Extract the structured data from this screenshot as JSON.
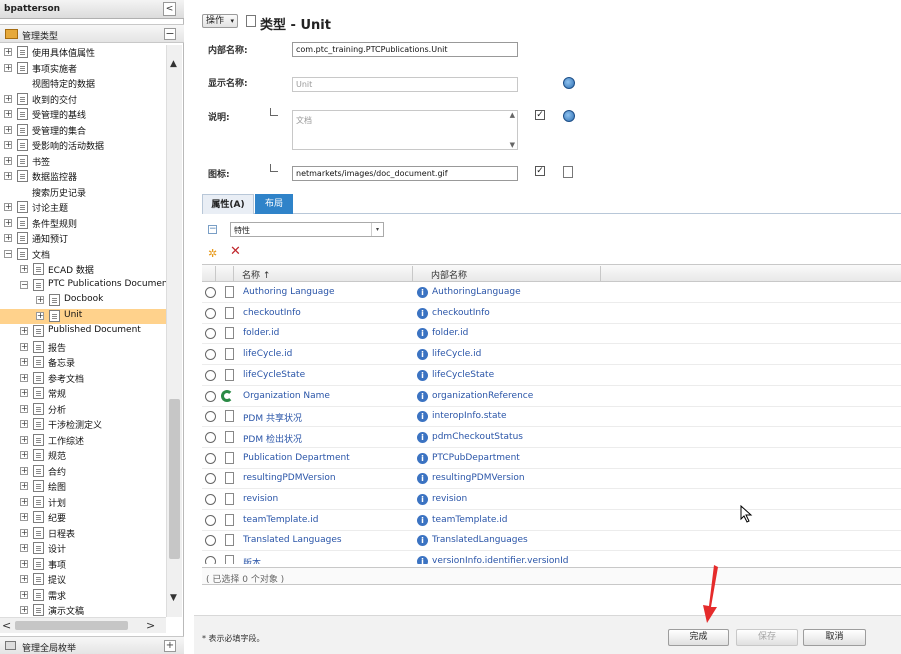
{
  "left_panel": {
    "user_name": "bpatterson",
    "collapse_glyph": "<",
    "section_title": "管理类型",
    "tree": [
      {
        "label": "使用具体值属性",
        "level": 0,
        "toggle": "+",
        "icon": "doc"
      },
      {
        "label": "事项实施者",
        "level": 0,
        "toggle": "+",
        "icon": "doc"
      },
      {
        "label": "视图特定的数据",
        "level": 0,
        "toggle": "",
        "icon": ""
      },
      {
        "label": "收到的交付",
        "level": 0,
        "toggle": "+",
        "icon": "doc"
      },
      {
        "label": "受管理的基线",
        "level": 0,
        "toggle": "+",
        "icon": "doc"
      },
      {
        "label": "受管理的集合",
        "level": 0,
        "toggle": "+",
        "icon": "doc"
      },
      {
        "label": "受影响的活动数据",
        "level": 0,
        "toggle": "+",
        "icon": "doc"
      },
      {
        "label": "书签",
        "level": 0,
        "toggle": "+",
        "icon": "doc"
      },
      {
        "label": "数据监控器",
        "level": 0,
        "toggle": "+",
        "icon": "doc"
      },
      {
        "label": "搜索历史记录",
        "level": 0,
        "toggle": "",
        "icon": ""
      },
      {
        "label": "讨论主题",
        "level": 0,
        "toggle": "+",
        "icon": "doc"
      },
      {
        "label": "条件型规则",
        "level": 0,
        "toggle": "+",
        "icon": "doc"
      },
      {
        "label": "通知预订",
        "level": 0,
        "toggle": "+",
        "icon": "doc"
      },
      {
        "label": "文档",
        "level": 0,
        "toggle": "−",
        "icon": "doc"
      },
      {
        "label": "ECAD 数据",
        "level": 1,
        "toggle": "+",
        "icon": "doc"
      },
      {
        "label": "PTC Publications Document",
        "level": 1,
        "toggle": "−",
        "icon": "doc"
      },
      {
        "label": "Docbook",
        "level": 2,
        "toggle": "+",
        "icon": "doc"
      },
      {
        "label": "Unit",
        "level": 2,
        "toggle": "+",
        "icon": "doc",
        "selected": true
      },
      {
        "label": "Published Document",
        "level": 1,
        "toggle": "+",
        "icon": "doc"
      },
      {
        "label": "报告",
        "level": 1,
        "toggle": "+",
        "icon": "doc"
      },
      {
        "label": "备忘录",
        "level": 1,
        "toggle": "+",
        "icon": "doc"
      },
      {
        "label": "参考文档",
        "level": 1,
        "toggle": "+",
        "icon": "doc"
      },
      {
        "label": "常规",
        "level": 1,
        "toggle": "+",
        "icon": "doc"
      },
      {
        "label": "分析",
        "level": 1,
        "toggle": "+",
        "icon": "doc"
      },
      {
        "label": "干涉检测定义",
        "level": 1,
        "toggle": "+",
        "icon": "doc"
      },
      {
        "label": "工作综述",
        "level": 1,
        "toggle": "+",
        "icon": "doc"
      },
      {
        "label": "规范",
        "level": 1,
        "toggle": "+",
        "icon": "doc"
      },
      {
        "label": "合约",
        "level": 1,
        "toggle": "+",
        "icon": "doc"
      },
      {
        "label": "绘图",
        "level": 1,
        "toggle": "+",
        "icon": "doc"
      },
      {
        "label": "计划",
        "level": 1,
        "toggle": "+",
        "icon": "doc"
      },
      {
        "label": "纪要",
        "level": 1,
        "toggle": "+",
        "icon": "doc"
      },
      {
        "label": "日程表",
        "level": 1,
        "toggle": "+",
        "icon": "doc"
      },
      {
        "label": "设计",
        "level": 1,
        "toggle": "+",
        "icon": "doc"
      },
      {
        "label": "事项",
        "level": 1,
        "toggle": "+",
        "icon": "doc"
      },
      {
        "label": "提议",
        "level": 1,
        "toggle": "+",
        "icon": "doc"
      },
      {
        "label": "需求",
        "level": 1,
        "toggle": "+",
        "icon": "doc"
      },
      {
        "label": "演示文稿",
        "level": 1,
        "toggle": "+",
        "icon": "doc"
      }
    ],
    "scroll_up": "▲",
    "scroll_down": "▼",
    "scroll_left": "<",
    "scroll_right": ">",
    "bottom_section_title": "管理全局枚举",
    "bottom_plus": "+"
  },
  "header": {
    "action_menu_label": "操作",
    "action_menu_caret": "▾",
    "title": "类型 - Unit"
  },
  "form": {
    "internal_name_label": "内部名称:",
    "internal_name_value": "com.ptc_training.PTCPublications.Unit",
    "display_name_label": "显示名称:",
    "display_name_value": "Unit",
    "description_label": "说明:",
    "description_value": "文档",
    "description_checked": "✓",
    "icon_label": "图标:",
    "icon_value": "netmarkets/images/doc_document.gif",
    "icon_checked": "✓"
  },
  "tabs": [
    {
      "label": "属性(A)",
      "active": false
    },
    {
      "label": "布局",
      "active": true
    }
  ],
  "group_toggle": "−",
  "group_select": {
    "value": "特性",
    "caret": "▾"
  },
  "toolbar": {
    "new_icon": "✲",
    "delete_icon": "✕"
  },
  "table": {
    "columns": [
      "名称 ↑",
      "内部名称"
    ],
    "rows": [
      {
        "name": "Authoring Language",
        "internal": "AuthoringLanguage",
        "icon": "doc"
      },
      {
        "name": "checkoutInfo",
        "internal": "checkoutInfo",
        "icon": "doc"
      },
      {
        "name": "folder.id",
        "internal": "folder.id",
        "icon": "doc"
      },
      {
        "name": "lifeCycle.id",
        "internal": "lifeCycle.id",
        "icon": "doc"
      },
      {
        "name": "lifeCycleState",
        "internal": "lifeCycleState",
        "icon": "doc"
      },
      {
        "name": "Organization Name",
        "internal": "organizationReference",
        "icon": "ref"
      },
      {
        "name": "PDM 共享状况",
        "internal": "interopInfo.state",
        "icon": "doc"
      },
      {
        "name": "PDM 检出状况",
        "internal": "pdmCheckoutStatus",
        "icon": "doc"
      },
      {
        "name": "Publication Department",
        "internal": "PTCPubDepartment",
        "icon": "doc"
      },
      {
        "name": "resultingPDMVersion",
        "internal": "resultingPDMVersion",
        "icon": "doc"
      },
      {
        "name": "revision",
        "internal": "revision",
        "icon": "doc"
      },
      {
        "name": "teamTemplate.id",
        "internal": "teamTemplate.id",
        "icon": "doc"
      },
      {
        "name": "Translated Languages",
        "internal": "TranslatedLanguages",
        "icon": "doc"
      },
      {
        "name": "版本",
        "internal": "versionInfo.identifier.versionId",
        "icon": "doc"
      }
    ],
    "info_glyph": "i",
    "selection_count": "( 已选择 0 个对象 )"
  },
  "footer": {
    "required_note": "* 表示必填字段。",
    "done_label": "完成",
    "save_label": "保存",
    "cancel_label": "取消"
  },
  "colors": {
    "tab_active": "#2f83c9",
    "link": "#2a55a8",
    "selected_row": "#ffd28c",
    "arrow": "#e52b2b"
  }
}
